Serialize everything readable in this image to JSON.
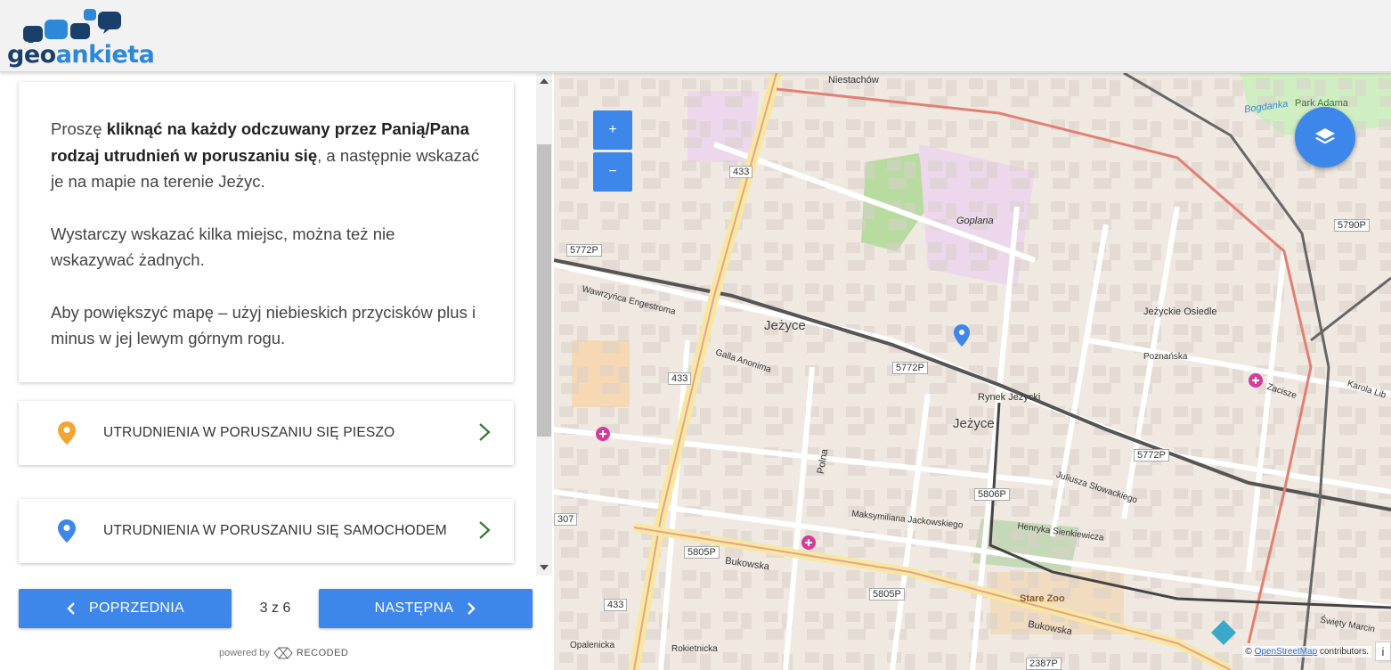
{
  "header": {
    "logo_text_part1": "geo",
    "logo_text_part2": "ankieta"
  },
  "intro": {
    "p1_pre": "Proszę ",
    "p1_bold": "kliknąć na każdy odczuwany przez Panią/Pana rodzaj utrudnień w poruszaniu się",
    "p1_post": ", a następnie wskazać je na mapie na terenie Jeżyc.",
    "p2": "Wystarczy wskazać kilka miejsc, można też nie wskazywać żadnych.",
    "p3": "Aby powiększyć mapę – użyj niebieskich przycisków plus i minus w jej lewym górnym rogu."
  },
  "options": [
    {
      "label": "UTRUDNIENIA W PORUSZANIU SIĘ PIESZO",
      "pin_color": "#f2a531"
    },
    {
      "label": "UTRUDNIENIA W PORUSZANIU SIĘ SAMOCHODEM",
      "pin_color": "#3d86ea"
    }
  ],
  "nav": {
    "prev_label": "POPRZEDNIA",
    "next_label": "NASTĘPNA",
    "pager": "3 z 6"
  },
  "footer": {
    "powered_by": "powered by",
    "brand": "RECODED"
  },
  "map": {
    "zoom_in": "+",
    "zoom_out": "−",
    "attribution_link": "OpenStreetMap",
    "attribution_rest": " contributors.",
    "info": "i",
    "labels": {
      "jezyce_top": "Jeżyce",
      "jezyce_mid": "Jeżyce",
      "niestachow": "Niestachów",
      "goplana": "Goplana",
      "rynek": "Rynek Jeżycki",
      "osiedle": "Jeżyckie Osiedle",
      "stare_zoo": "Stare Zoo",
      "bukowska": "Bukowska",
      "bukowska2": "Bukowska",
      "poznanska": "Poznańska",
      "polna": "Polna",
      "galla": "Galla Anonima",
      "zachodnia": "Wawrzyńca Engestroma",
      "sienkiewicza": "Henryka Sienkiewicza",
      "jackowskiego": "Maksymiliana Jackowskiego",
      "slowackiego": "Juliusza Słowackiego",
      "karola": "Karola Lib",
      "zacisze": "Zacisze",
      "bogdanka": "Bogdanka",
      "park": "Park Adama",
      "opalenicka": "Opalenicka",
      "rokietnicka": "Rokietnicka",
      "swiety": "Święty Marcin"
    },
    "shields": {
      "s5772a": "5772P",
      "s433a": "433",
      "s5772b": "5772P",
      "s433b": "433",
      "s5772c": "5772P",
      "s5806": "5806P",
      "s5790": "5790P",
      "s5805a": "5805P",
      "s5805b": "5805P",
      "s433c": "433",
      "s307": "307",
      "s2387": "2387P"
    }
  }
}
